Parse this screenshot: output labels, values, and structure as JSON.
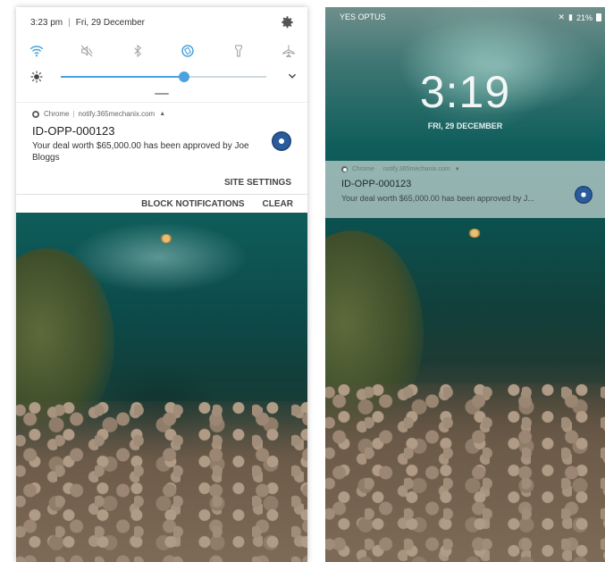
{
  "left_screen": {
    "status": {
      "time": "3:23 pm",
      "date": "Fri, 29 December"
    },
    "quick_settings": {
      "icons": [
        "wifi-icon",
        "mute-icon",
        "bluetooth-icon",
        "auto-rotate-icon",
        "flashlight-icon",
        "airplane-mode-icon"
      ],
      "brightness_level": 0.6
    },
    "notification": {
      "app": "Chrome",
      "source": "notify.365mechanix.com",
      "title": "ID-OPP-000123",
      "body": "Your deal worth $65,000.00 has been approved by Joe Bloggs",
      "site_settings_label": "SITE SETTINGS",
      "block_label": "BLOCK NOTIFICATIONS",
      "clear_label": "CLEAR"
    }
  },
  "right_screen": {
    "carrier": "YES OPTUS",
    "battery": "21%",
    "clock": "3:19",
    "date": "FRI, 29 DECEMBER",
    "notification": {
      "app": "Chrome",
      "source": "notify.365mechanix.com",
      "title": "ID-OPP-000123",
      "body": "Your deal worth $65,000.00 has been approved by J..."
    }
  },
  "colors": {
    "accent": "#4aa3e0"
  }
}
